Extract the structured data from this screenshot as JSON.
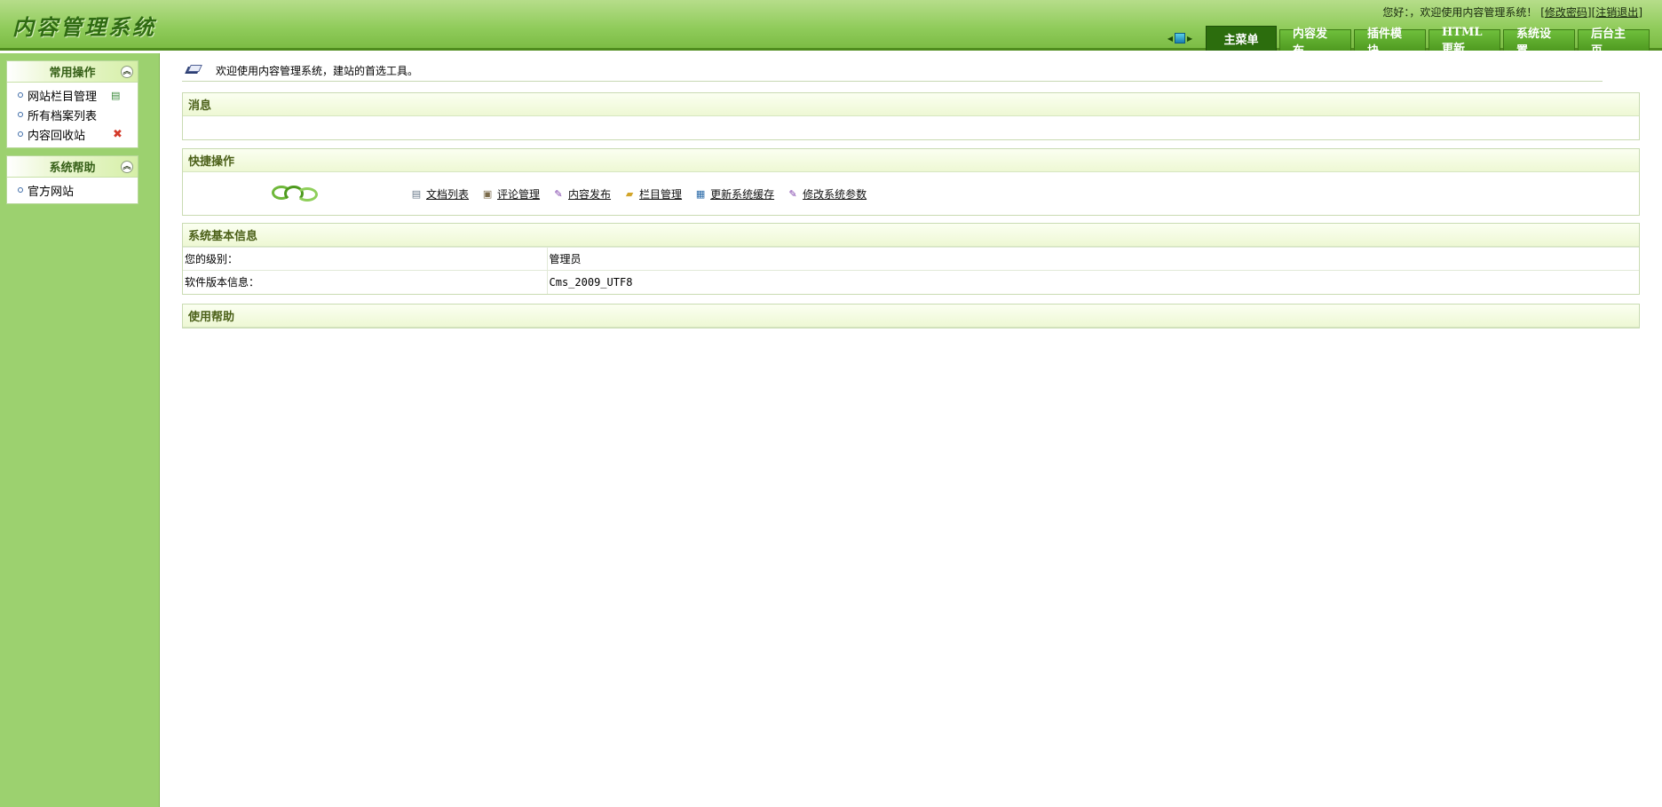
{
  "header": {
    "logo": "内容管理系统",
    "greeting": "您好：，欢迎使用内容管理系统！",
    "change_password": "修改密码",
    "logout": "注销退出",
    "nav_tabs": [
      "主菜单",
      "内容发布",
      "插件模块",
      "HTML更新",
      "系统设置",
      "后台主页"
    ],
    "active_tab": "主菜单"
  },
  "sidebar": {
    "panels": [
      {
        "title": "常用操作",
        "items": [
          {
            "label": "网站栏目管理",
            "icon": "page-add-icon"
          },
          {
            "label": "所有档案列表"
          },
          {
            "label": "内容回收站",
            "icon": "delete-x-icon"
          }
        ]
      },
      {
        "title": "系统帮助",
        "items": [
          {
            "label": "官方网站"
          }
        ]
      }
    ]
  },
  "main": {
    "welcome": "欢迎使用内容管理系统，建站的首选工具。",
    "messages": {
      "title": "消息"
    },
    "quick": {
      "title": "快捷操作",
      "links": [
        {
          "label": "文档列表",
          "icon": "document-icon"
        },
        {
          "label": "评论管理",
          "icon": "comment-icon"
        },
        {
          "label": "内容发布",
          "icon": "pen-icon"
        },
        {
          "label": "栏目管理",
          "icon": "folder-icon"
        },
        {
          "label": "更新系统缓存",
          "icon": "refresh-icon"
        },
        {
          "label": "修改系统参数",
          "icon": "pen-icon"
        }
      ]
    },
    "sysinfo": {
      "title": "系统基本信息",
      "rows": [
        {
          "key": "您的级别：",
          "value": "管理员"
        },
        {
          "key": "软件版本信息：",
          "value": "Cms_2009_UTF8"
        }
      ]
    },
    "help": {
      "title": "使用帮助"
    }
  }
}
